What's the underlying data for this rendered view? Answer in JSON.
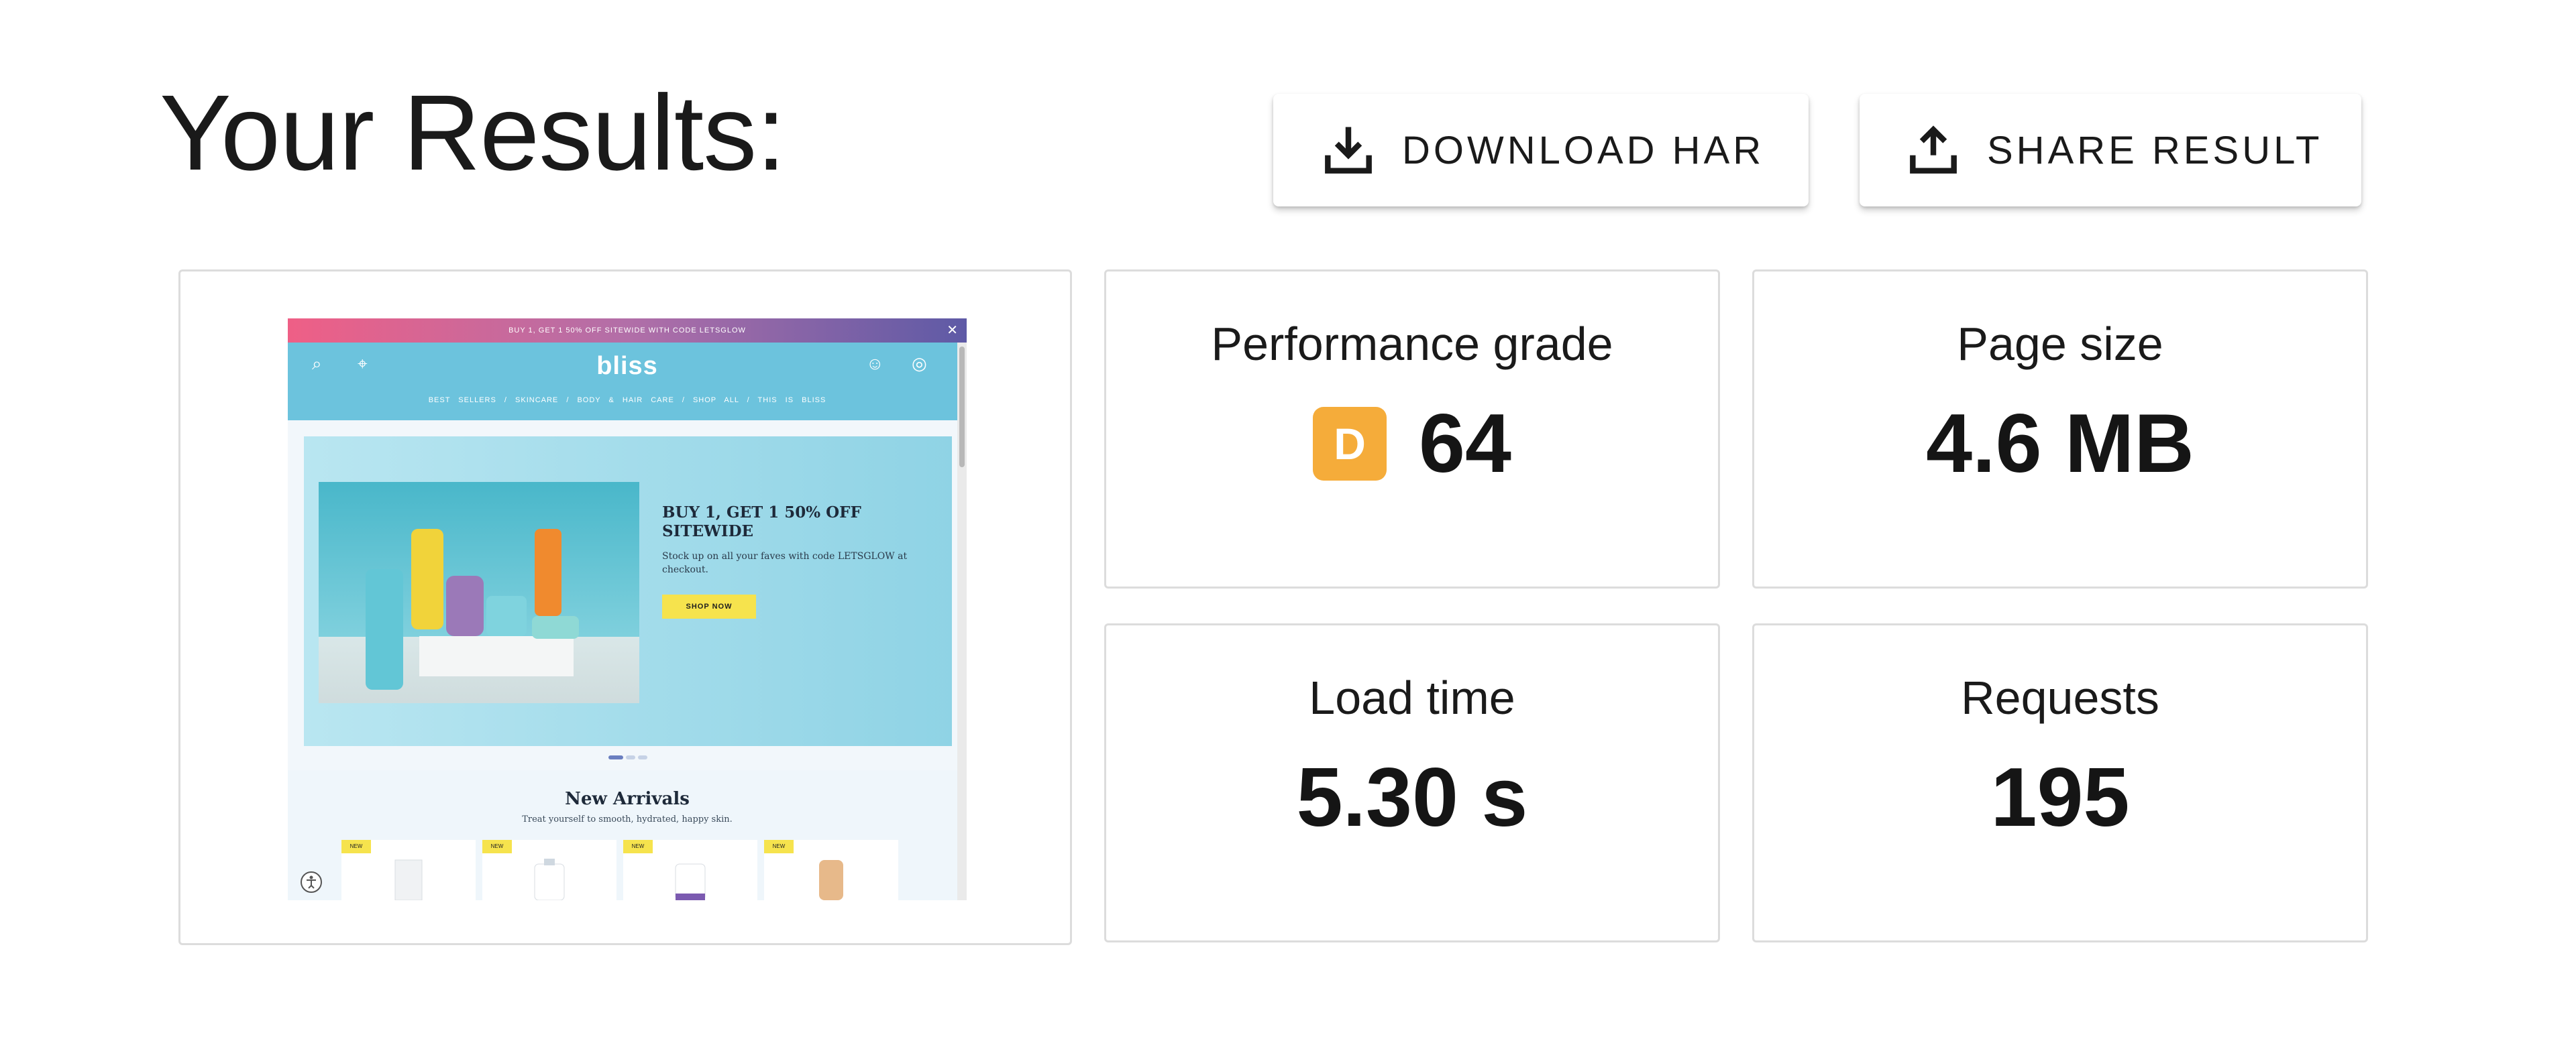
{
  "header": {
    "title": "Your Results:"
  },
  "actions": {
    "download_label": "DOWNLOAD HAR",
    "share_label": "SHARE RESULT"
  },
  "metrics": {
    "performance": {
      "label": "Performance grade",
      "grade": "D",
      "score": "64",
      "grade_color": "#f5ac3a"
    },
    "page_size": {
      "label": "Page size",
      "value": "4.6 MB"
    },
    "load_time": {
      "label": "Load time",
      "value": "5.30 s"
    },
    "requests": {
      "label": "Requests",
      "value": "195"
    }
  },
  "preview": {
    "promo_text": "BUY 1, GET 1 50% OFF SITEWIDE WITH CODE LETSGLOW",
    "logo": "bliss",
    "nav": [
      "BEST SELLERS",
      "/",
      "SKINCARE",
      "/",
      "BODY & HAIR CARE",
      "/",
      "SHOP ALL",
      "/",
      "THIS IS BLISS"
    ],
    "hero_title": "BUY 1, GET 1 50% OFF SITEWIDE",
    "hero_copy": "Stock up on all your faves with code LETSGLOW at checkout.",
    "hero_cta": "SHOP NOW",
    "section_title": "New Arrivals",
    "section_subtitle": "Treat yourself to smooth, hydrated, happy skin.",
    "product_tag": "NEW",
    "colors": {
      "header": "#6cc3dd",
      "promo_start": "#ef5f86",
      "promo_end": "#5e5aa6",
      "cta": "#f6e34d"
    }
  }
}
